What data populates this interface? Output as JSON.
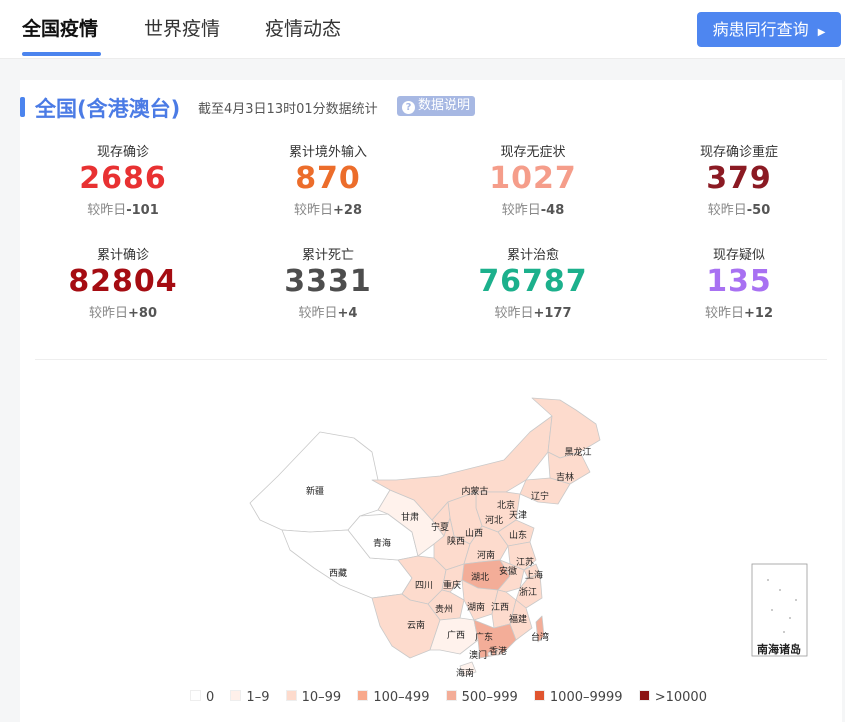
{
  "tabs": [
    {
      "label": "全国疫情"
    },
    {
      "label": "世界疫情"
    },
    {
      "label": "疫情动态"
    }
  ],
  "query_button": "病患同行查询",
  "card": {
    "title": "全国(含港澳台)",
    "subtitle": "截至4月3日13时01分数据统计",
    "info_label": "数据说明"
  },
  "stats": [
    {
      "label": "现存确诊",
      "value": "2686",
      "delta_prefix": "较昨日",
      "delta": "-101",
      "color": "#e83132"
    },
    {
      "label": "累计境外输入",
      "value": "870",
      "delta_prefix": "较昨日",
      "delta": "+28",
      "color": "#ec6d2b"
    },
    {
      "label": "现存无症状",
      "value": "1027",
      "delta_prefix": "较昨日",
      "delta": "-48",
      "color": "#f59d8a"
    },
    {
      "label": "现存确诊重症",
      "value": "379",
      "delta_prefix": "较昨日",
      "delta": "-50",
      "color": "#8b1a23"
    },
    {
      "label": "累计确诊",
      "value": "82804",
      "delta_prefix": "较昨日",
      "delta": "+80",
      "color": "#a50c12"
    },
    {
      "label": "累计死亡",
      "value": "3331",
      "delta_prefix": "较昨日",
      "delta": "+4",
      "color": "#4d4d4d"
    },
    {
      "label": "累计治愈",
      "value": "76787",
      "delta_prefix": "较昨日",
      "delta": "+177",
      "color": "#1cb08c"
    },
    {
      "label": "现存疑似",
      "value": "135",
      "delta_prefix": "较昨日",
      "delta": "+12",
      "color": "#a871f2"
    }
  ],
  "map": {
    "provinces": [
      "新疆",
      "西藏",
      "青海",
      "甘肃",
      "宁夏",
      "内蒙古",
      "黑龙江",
      "吉林",
      "辽宁",
      "北京",
      "天津",
      "河北",
      "山西",
      "陕西",
      "山东",
      "河南",
      "湖北",
      "江苏",
      "安徽",
      "上海",
      "浙江",
      "四川",
      "重庆",
      "贵州",
      "湖南",
      "江西",
      "福建",
      "云南",
      "广西",
      "广东",
      "澳门",
      "香港",
      "台湾",
      "海南"
    ],
    "inset_label": "南海诸岛"
  },
  "legend": [
    {
      "label": "0",
      "color": "#ffffff"
    },
    {
      "label": "1–9",
      "color": "#fff0ea"
    },
    {
      "label": "10–99",
      "color": "#fddbcd"
    },
    {
      "label": "100–499",
      "color": "#f8a98c"
    },
    {
      "label": "500–999",
      "color": "#f3ad98"
    },
    {
      "label": "1000–9999",
      "color": "#e0552f"
    },
    {
      "label": ">10000",
      "color": "#8c1212"
    }
  ]
}
